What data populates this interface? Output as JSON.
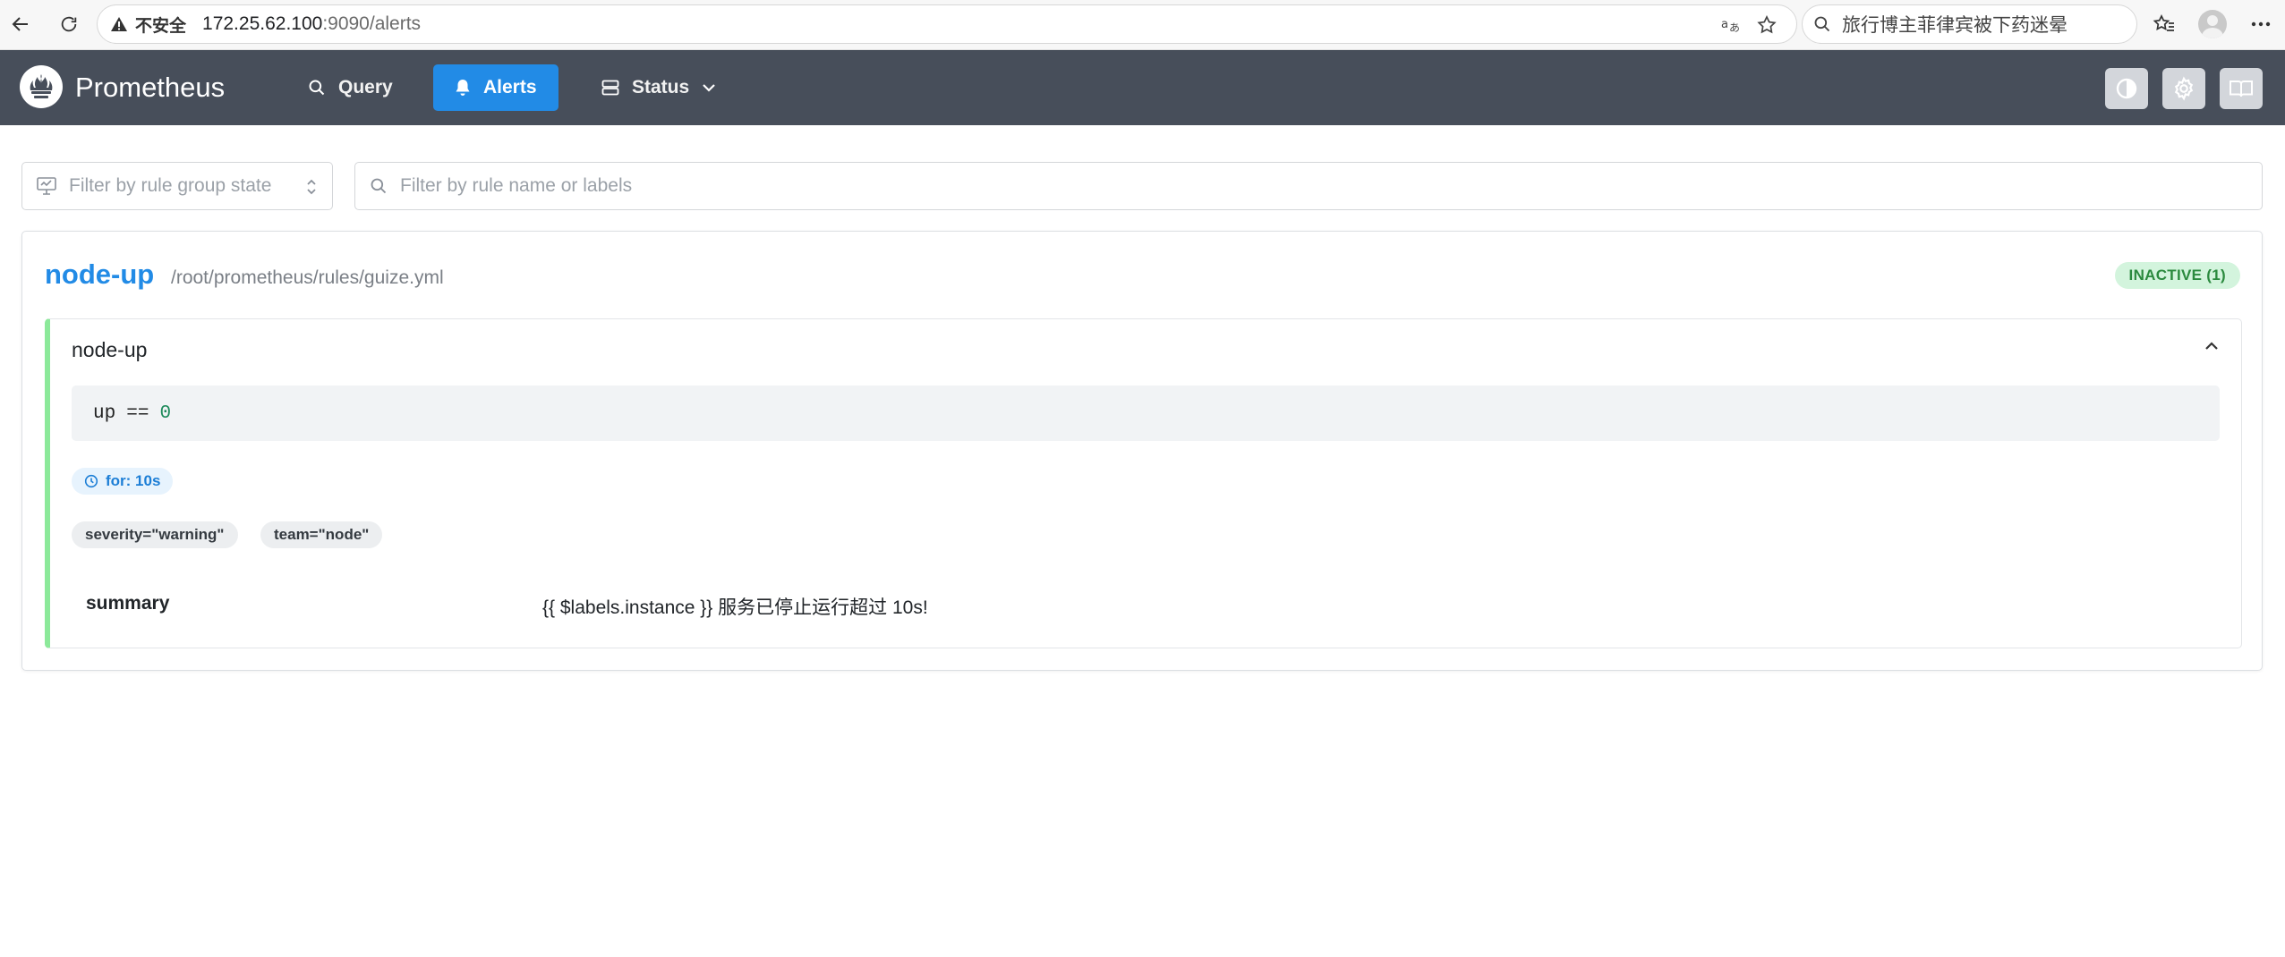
{
  "browser": {
    "insecure_label": "不安全",
    "url_host": "172.25.62.100",
    "url_path": ":9090/alerts",
    "search_text": "旅行博主菲律宾被下药迷晕"
  },
  "header": {
    "brand": "Prometheus",
    "nav": {
      "query": "Query",
      "alerts": "Alerts",
      "status": "Status"
    }
  },
  "filters": {
    "state_placeholder": "Filter by rule group state",
    "search_placeholder": "Filter by rule name or labels"
  },
  "group": {
    "name": "node-up",
    "file": "/root/prometheus/rules/guize.yml",
    "status": "INACTIVE (1)",
    "rule": {
      "name": "node-up",
      "expr_metric": "up",
      "expr_op": "==",
      "expr_value": "0",
      "for": "for: 10s",
      "labels": [
        "severity=\"warning\"",
        "team=\"node\""
      ],
      "annotation_key": "summary",
      "annotation_value": "{{ $labels.instance }} 服务已停止运行超过 10s!"
    }
  },
  "colors": {
    "header_bg": "#474e5a",
    "accent": "#228be6",
    "inactive_bg": "#d3f4dd",
    "inactive_text": "#2b8a3e",
    "rule_border": "#8ce99a"
  }
}
